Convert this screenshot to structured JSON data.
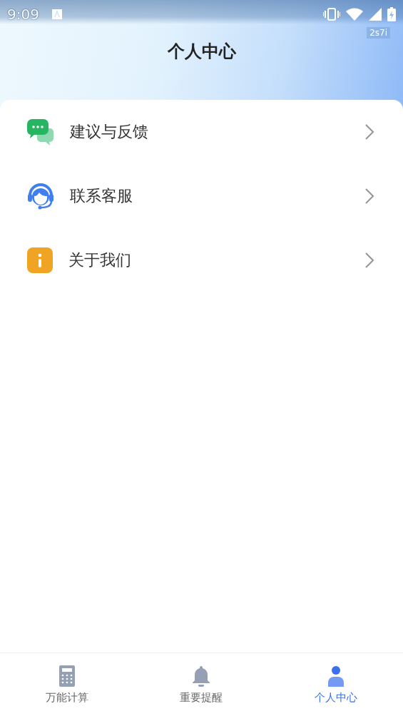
{
  "status_bar": {
    "time": "9:09",
    "badge": "2s7i"
  },
  "header": {
    "title": "个人中心"
  },
  "menu": [
    {
      "label": "建议与反馈",
      "kind": "feedback"
    },
    {
      "label": "联系客服",
      "kind": "support"
    },
    {
      "label": "关于我们",
      "kind": "about"
    }
  ],
  "tab_bar": [
    {
      "label": "万能计算",
      "kind": "calculator",
      "selected": false
    },
    {
      "label": "重要提醒",
      "kind": "bell",
      "selected": false
    },
    {
      "label": "个人中心",
      "kind": "person",
      "selected": true
    }
  ]
}
